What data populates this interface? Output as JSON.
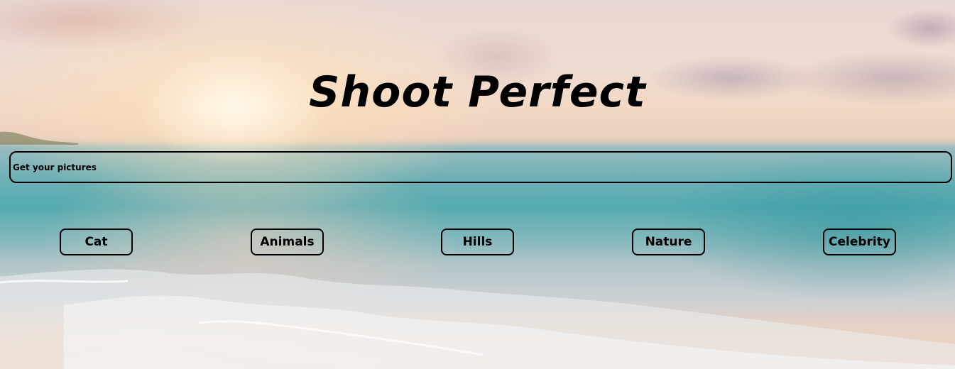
{
  "header": {
    "title": "Shoot Perfect"
  },
  "search": {
    "text": "Get your pictures"
  },
  "categories": [
    {
      "label": "Cat"
    },
    {
      "label": "Animals"
    },
    {
      "label": "Hills"
    },
    {
      "label": "Nature"
    },
    {
      "label": "Celebrity"
    }
  ],
  "colors": {
    "text": "#000000",
    "border": "#000000"
  },
  "background": {
    "image": "beach-sunset-background"
  }
}
